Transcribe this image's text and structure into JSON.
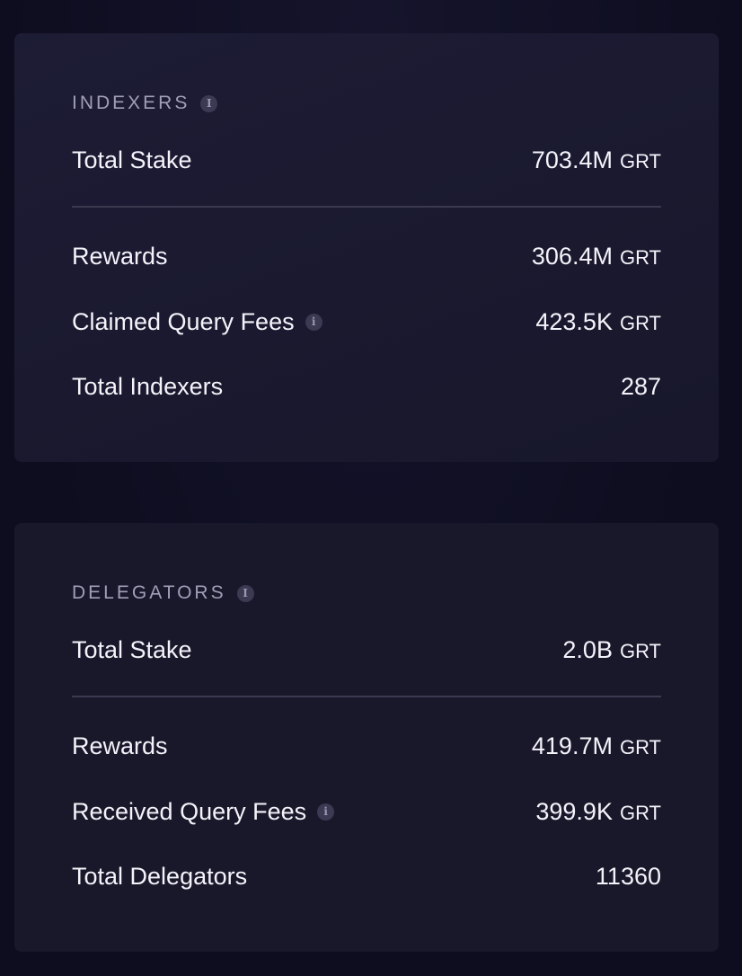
{
  "indexers": {
    "title": "INDEXERS",
    "rows": [
      {
        "label": "Total Stake",
        "value": "703.4M",
        "unit": "GRT"
      },
      {
        "label": "Rewards",
        "value": "306.4M",
        "unit": "GRT"
      },
      {
        "label": "Claimed Query Fees",
        "value": "423.5K",
        "unit": "GRT"
      },
      {
        "label": "Total Indexers",
        "value": "287"
      }
    ]
  },
  "delegators": {
    "title": "DELEGATORS",
    "rows": [
      {
        "label": "Total Stake",
        "value": "2.0B",
        "unit": "GRT"
      },
      {
        "label": "Rewards",
        "value": "419.7M",
        "unit": "GRT"
      },
      {
        "label": "Received Query Fees",
        "value": "399.9K",
        "unit": "GRT"
      },
      {
        "label": "Total Delegators",
        "value": "11360"
      }
    ]
  },
  "icons": {
    "info": "info-icon"
  }
}
